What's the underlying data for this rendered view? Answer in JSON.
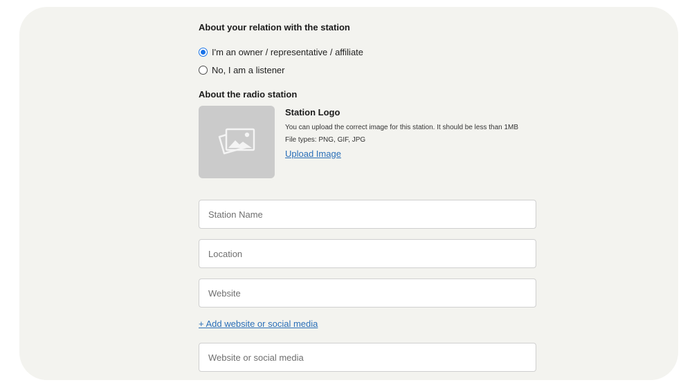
{
  "relation": {
    "heading": "About your relation with the station",
    "options": [
      {
        "label": "I'm an owner / representative / affiliate",
        "selected": true
      },
      {
        "label": "No, I am a listener",
        "selected": false
      }
    ]
  },
  "station": {
    "heading": "About the radio station",
    "logo": {
      "placeholder_icon": "image-placeholder-icon",
      "title": "Station Logo",
      "description": "You can upload the correct image for this station. It should be less than 1MB",
      "file_types": "File types: PNG, GIF, JPG",
      "upload_label": "Upload Image"
    },
    "fields": {
      "name": {
        "placeholder": "Station Name",
        "value": ""
      },
      "location": {
        "placeholder": "Location",
        "value": ""
      },
      "website": {
        "placeholder": "Website",
        "value": ""
      },
      "social": {
        "placeholder": "Website or social media",
        "value": ""
      }
    },
    "add_link_label": "+ Add website or social media"
  },
  "colors": {
    "panel_background": "#f3f3ef",
    "radio_accent": "#1a73e8",
    "link": "#2a6fb8",
    "logo_placeholder": "#cbcbcb"
  }
}
